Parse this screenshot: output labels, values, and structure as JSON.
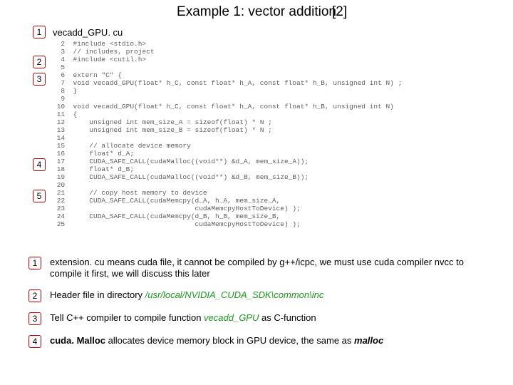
{
  "title": "Example 1: vector addition",
  "title_ref": "[2]",
  "filename": "vecadd_GPU. cu",
  "code_lines": [
    "#include <stdio.h>",
    "// includes, project",
    "#include <cutil.h>",
    "",
    "extern \"C\" {",
    "void vecadd_GPU(float* h_C, const float* h_A, const float* h_B, unsigned int N) ;",
    "}",
    "",
    "void vecadd_GPU(float* h_C, const float* h_A, const float* h_B, unsigned int N)",
    "{",
    "    unsigned int mem_size_A = sizeof(float) * N ;",
    "    unsigned int mem_size_B = sizeof(float) * N ;",
    "",
    "    // allocate device memory",
    "    float* d_A;",
    "    CUDA_SAFE_CALL(cudaMalloc((void**) &d_A, mem_size_A));",
    "    float* d_B;",
    "    CUDA_SAFE_CALL(cudaMalloc((void**) &d_B, mem_size_B));",
    "",
    "    // copy host memory to device",
    "    CUDA_SAFE_CALL(cudaMemcpy(d_A, h_A, mem_size_A,",
    "                              cudaMemcpyHostToDevice) );",
    "    CUDA_SAFE_CALL(cudaMemcpy(d_B, h_B, mem_size_B,",
    "                              cudaMemcpyHostToDevice) );"
  ],
  "left_markers": [
    "1",
    "2",
    "3",
    "4",
    "5"
  ],
  "notes": [
    {
      "n": "1",
      "pre": "extension. cu means cuda file, it cannot be compiled by g++/icpc, we must use cuda compiler nvcc to compile it first, we will discuss this later"
    },
    {
      "n": "2",
      "pre": "Header file in directory ",
      "green": "/usr/local/NVIDIA_CUDA_SDK\\common\\inc"
    },
    {
      "n": "3",
      "pre": "Tell C++ compiler to compile function ",
      "green": "vecadd_GPU",
      "post": " as C-function"
    },
    {
      "n": "4",
      "bold1": "cuda. Malloc",
      "mid": " allocates device memory block in GPU device, the same as ",
      "bold2": "malloc"
    }
  ]
}
